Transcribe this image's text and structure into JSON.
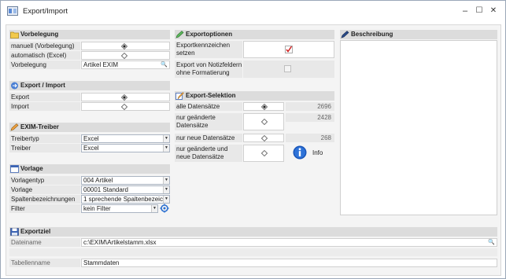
{
  "window": {
    "title": "Export/Import",
    "minimize": "–",
    "maximize": "☐",
    "close": "✕"
  },
  "vorbelegung": {
    "header": "Vorbelegung",
    "rows": [
      {
        "label": "manuell (Vorbelegung)",
        "selected": true
      },
      {
        "label": "automatisch (Excel)",
        "selected": false
      }
    ],
    "field_label": "Vorbelegung",
    "field_value": "Artikel EXIM"
  },
  "export_import": {
    "header": "Export / Import",
    "rows": [
      {
        "label": "Export",
        "selected": true
      },
      {
        "label": "Import",
        "selected": false
      }
    ]
  },
  "exim_treiber": {
    "header": "EXIM-Treiber",
    "treibertyp_label": "Treibertyp",
    "treibertyp_value": "Excel",
    "treiber_label": "Treiber",
    "treiber_value": "Excel"
  },
  "vorlage": {
    "header": "Vorlage",
    "vorlagentyp_label": "Vorlagentyp",
    "vorlagentyp_value": "004 Artikel",
    "vorlage_label": "Vorlage",
    "vorlage_value": "00001 Standard",
    "spalten_label": "Spaltenbezeichnungen",
    "spalten_value": "1 sprechende Spaltenbezeic",
    "filter_label": "Filter",
    "filter_value": "kein Filter"
  },
  "exportoptionen": {
    "header": "Exportoptionen",
    "kennzeichen_label": "Exportkennzeichen setzen",
    "kennzeichen_checked": true,
    "notiz_label": "Export von Notizfeldern ohne Formatierung",
    "notiz_checked": false
  },
  "export_selektion": {
    "header": "Export-Selektion",
    "rows": [
      {
        "label": "alle Datensätze",
        "count": "2696",
        "selected": true
      },
      {
        "label": "nur geänderte Datensätze",
        "count": "2428",
        "selected": false
      },
      {
        "label": "nur neue Datensätze",
        "count": "268",
        "selected": false
      },
      {
        "label": "nur geänderte und neue Datensätze",
        "count": "",
        "selected": false
      }
    ],
    "info_label": "Info"
  },
  "beschreibung": {
    "header": "Beschreibung"
  },
  "exportziel": {
    "header": "Exportziel",
    "dateiname_label": "Dateiname",
    "dateiname_value": "c:\\EXIM\\Artikelstamm.xlsx",
    "tabellenname_label": "Tabellenname",
    "tabellenname_value": "Stammdaten"
  },
  "colors": {
    "section_header_bg": "#dcdcdc",
    "label_bg": "#e8e8e8",
    "check_red": "#d02020",
    "info_blue": "#1a56b8"
  }
}
